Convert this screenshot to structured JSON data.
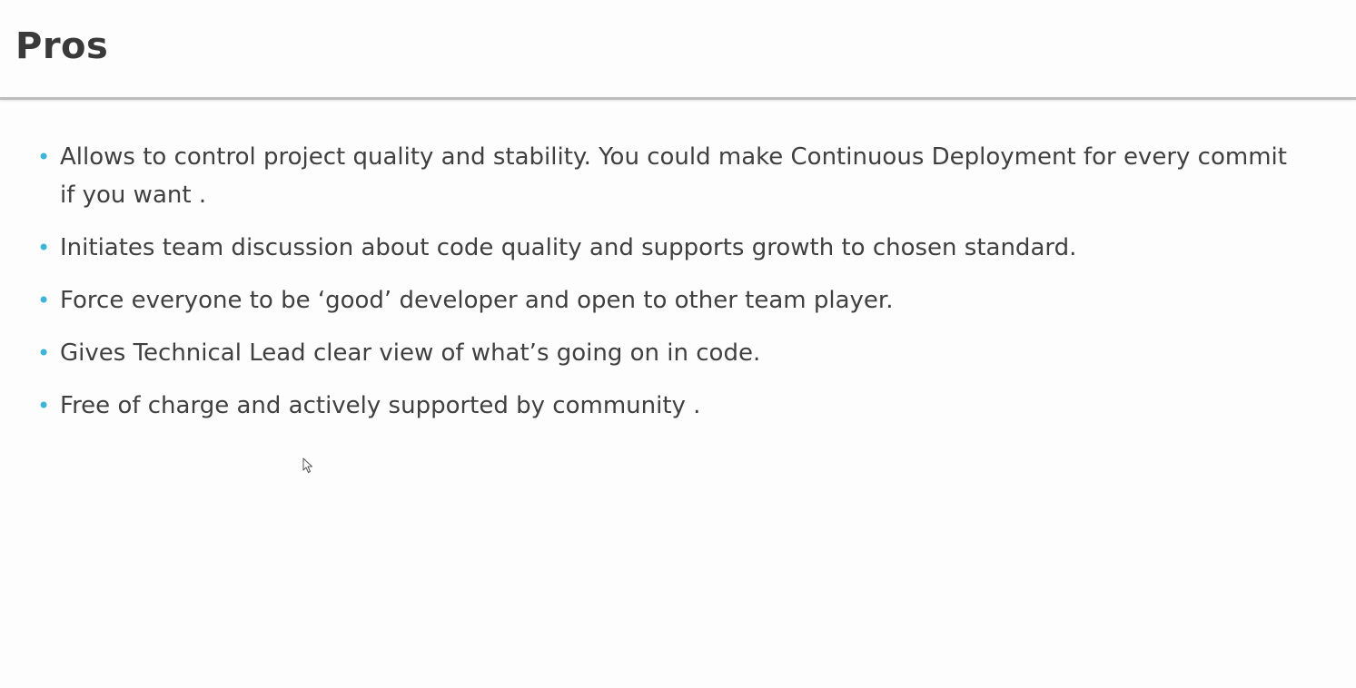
{
  "slide": {
    "title": "Pros",
    "bullets": [
      {
        "text": "Allows to control project quality and stability. You could make Continuous Deployment for every commit if you want ."
      },
      {
        "text": "Initiates team discussion about code quality and supports growth to chosen standard."
      },
      {
        "text": "Force everyone to be ‘good’ developer and open to other team player."
      },
      {
        "text": "Gives Technical Lead clear view of what’s going on in code."
      },
      {
        "text": "Free of charge and actively supported by community ."
      }
    ]
  },
  "icons": {
    "bullet": "bullet-dot-icon",
    "cursor": "mouse-pointer-icon"
  },
  "colors": {
    "title": "#3a3a3a",
    "body_text": "#404040",
    "bullet_accent": "#3cb4d6",
    "divider": "#bdbdbd",
    "background": "#fdfdfd"
  }
}
